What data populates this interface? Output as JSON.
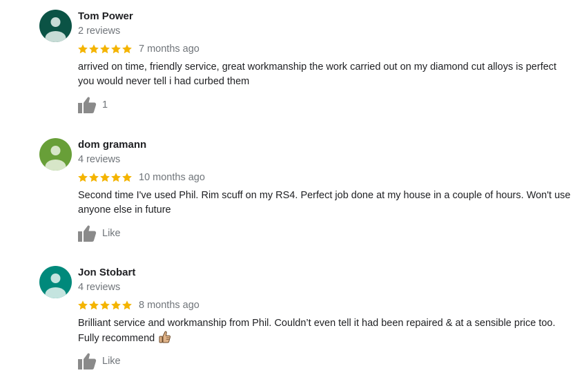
{
  "reviews": [
    {
      "name": "Tom Power",
      "count": "2 reviews",
      "rating": 5,
      "time": "7 months ago",
      "text": "arrived on time, friendly service, great workmanship the work carried out on my diamond cut alloys is perfect you would never tell i had curbed them",
      "like_label": "1",
      "avatar_color": "#0b5345"
    },
    {
      "name": "dom gramann",
      "count": "4 reviews",
      "rating": 5,
      "time": "10 months ago",
      "text": "Second time I've used Phil. Rim scuff on my RS4. Perfect job done at my house in a couple of hours. Won't use anyone else in future",
      "like_label": "Like",
      "avatar_color": "#689f38"
    },
    {
      "name": "Jon Stobart",
      "count": "4 reviews",
      "rating": 5,
      "time": "8 months ago",
      "text": "Brilliant service and workmanship from Phil. Couldn’t even tell it had been repaired & at a sensible price too. Fully recommend",
      "like_label": "Like",
      "avatar_color": "#00897b"
    }
  ],
  "colors": {
    "star": "#f4b400",
    "muted": "#70757a",
    "like_icon": "#8a8a8a"
  },
  "icons": {
    "avatar": "person-silhouette-icon",
    "star": "star-icon",
    "like": "thumbs-up-icon",
    "emoji": "thumbs-up-emoji"
  }
}
